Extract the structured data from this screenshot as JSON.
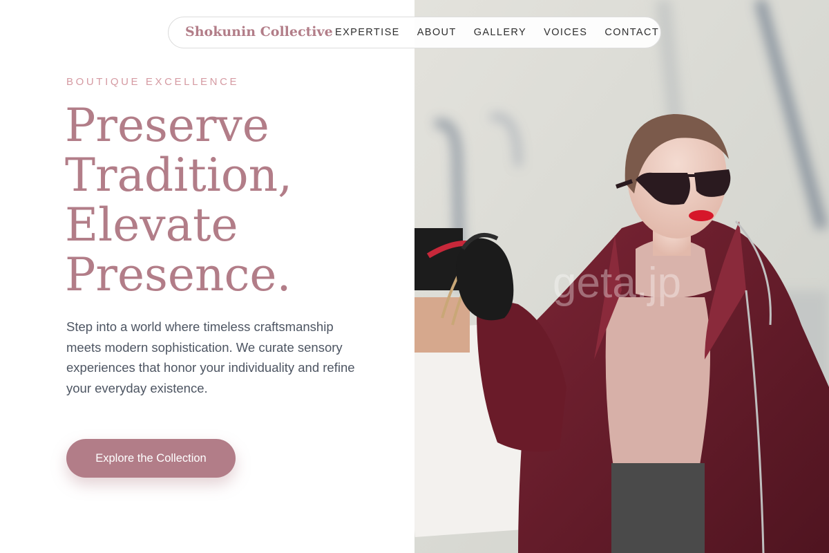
{
  "brand": {
    "name": "Shokunin Collective"
  },
  "nav": {
    "links": [
      {
        "label": "EXPERTISE"
      },
      {
        "label": "ABOUT"
      },
      {
        "label": "GALLERY"
      },
      {
        "label": "VOICES"
      },
      {
        "label": "CONTACT"
      }
    ]
  },
  "hero": {
    "eyebrow": "BOUTIQUE EXCELLENCE",
    "headline_lines": [
      "Preserve",
      "Tradition,",
      "Elevate",
      "Presence."
    ],
    "body": "Step into a world where timeless craftsmanship meets modern sophistication. We curate sensory experiences that honor your individuality and refine your everyday existence.",
    "cta_label": "Explore the Collection",
    "image_watermark": "geta.jp"
  },
  "colors": {
    "accent": "#b27d88",
    "eyebrow": "#d59aa2",
    "body_text": "#4d5562",
    "coat": "#6e1f2c"
  },
  "icons": []
}
